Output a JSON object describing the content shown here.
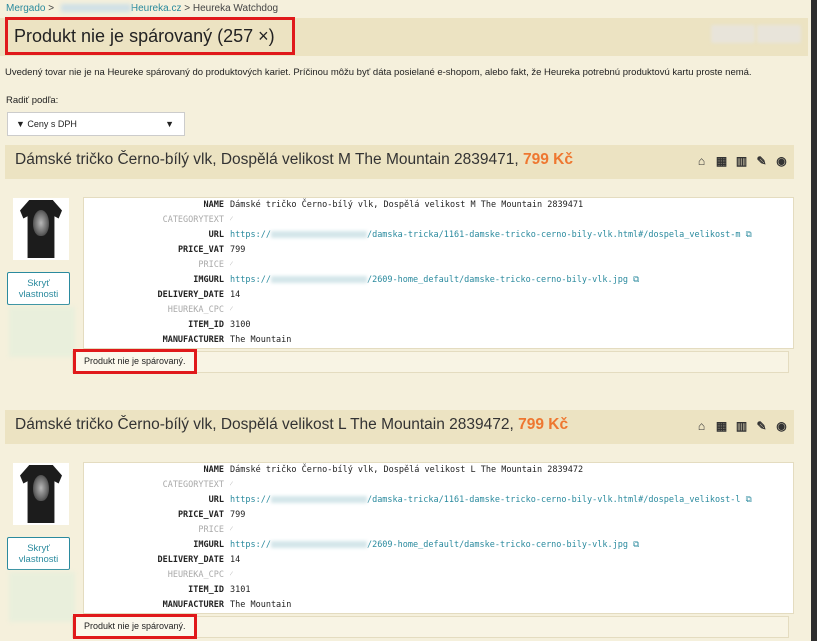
{
  "breadcrumb": {
    "root": "Mergado",
    "sep": ">",
    "shop": "Heureka.cz",
    "current": "Heureka Watchdog"
  },
  "page": {
    "title": "Produkt nie je spárovaný (257 ×)",
    "description": "Uvedený tovar nie je na Heureke spárovaný do produktových kariet. Príčinou môžu byť dáta posielané e-shopom, alebo fakt, že Heureka potrebnú produktovú kartu proste nemá."
  },
  "sort": {
    "label": "Radiť podľa:",
    "selected": "▼ Ceny s DPH",
    "arrow": "▼"
  },
  "icons": [
    "shop-icon",
    "qr-icon",
    "chart-icon",
    "pencil-icon",
    "hide-eye-icon"
  ],
  "labels": {
    "hide_properties": "Skryť vlastnosti",
    "status": "Produkt nie je spárovaný."
  },
  "products": [
    {
      "title": "Dámské tričko Černo-bílý vlk, Dospělá velikost M The Mountain 2839471,",
      "price": "799 Kč",
      "props": [
        {
          "k": "NAME",
          "v": "Dámské tričko Černo-bílý vlk, Dospělá velikost  M The Mountain 2839471"
        },
        {
          "k": "CATEGORYTEXT",
          "v": "⁄"
        },
        {
          "k": "URL",
          "v_prefix": "https://",
          "v": "/damska-tricka/1161-damske-tricko-cerno-bily-vlk.html#/dospela_velikost-m"
        },
        {
          "k": "PRICE_VAT",
          "v": "799"
        },
        {
          "k": "PRICE",
          "v": "⁄"
        },
        {
          "k": "IMGURL",
          "v_prefix": "https://",
          "v": "/2609-home_default/damske-tricko-cerno-bily-vlk.jpg"
        },
        {
          "k": "DELIVERY_DATE",
          "v": "14"
        },
        {
          "k": "HEUREKA_CPC",
          "v": "⁄"
        },
        {
          "k": "ITEM_ID",
          "v": "3100"
        },
        {
          "k": "MANUFACTURER",
          "v": "The Mountain"
        }
      ]
    },
    {
      "title": "Dámské tričko Černo-bílý vlk, Dospělá velikost L The Mountain 2839472,",
      "price": "799 Kč",
      "props": [
        {
          "k": "NAME",
          "v": "Dámské tričko Černo-bílý vlk, Dospělá velikost  L The Mountain 2839472"
        },
        {
          "k": "CATEGORYTEXT",
          "v": "⁄"
        },
        {
          "k": "URL",
          "v_prefix": "https://",
          "v": "/damska-tricka/1161-damske-tricko-cerno-bily-vlk.html#/dospela_velikost-l"
        },
        {
          "k": "PRICE_VAT",
          "v": "799"
        },
        {
          "k": "PRICE",
          "v": "⁄"
        },
        {
          "k": "IMGURL",
          "v_prefix": "https://",
          "v": "/2609-home_default/damske-tricko-cerno-bily-vlk.jpg"
        },
        {
          "k": "DELIVERY_DATE",
          "v": "14"
        },
        {
          "k": "HEUREKA_CPC",
          "v": "⁄"
        },
        {
          "k": "ITEM_ID",
          "v": "3101"
        },
        {
          "k": "MANUFACTURER",
          "v": "The Mountain"
        }
      ]
    }
  ]
}
